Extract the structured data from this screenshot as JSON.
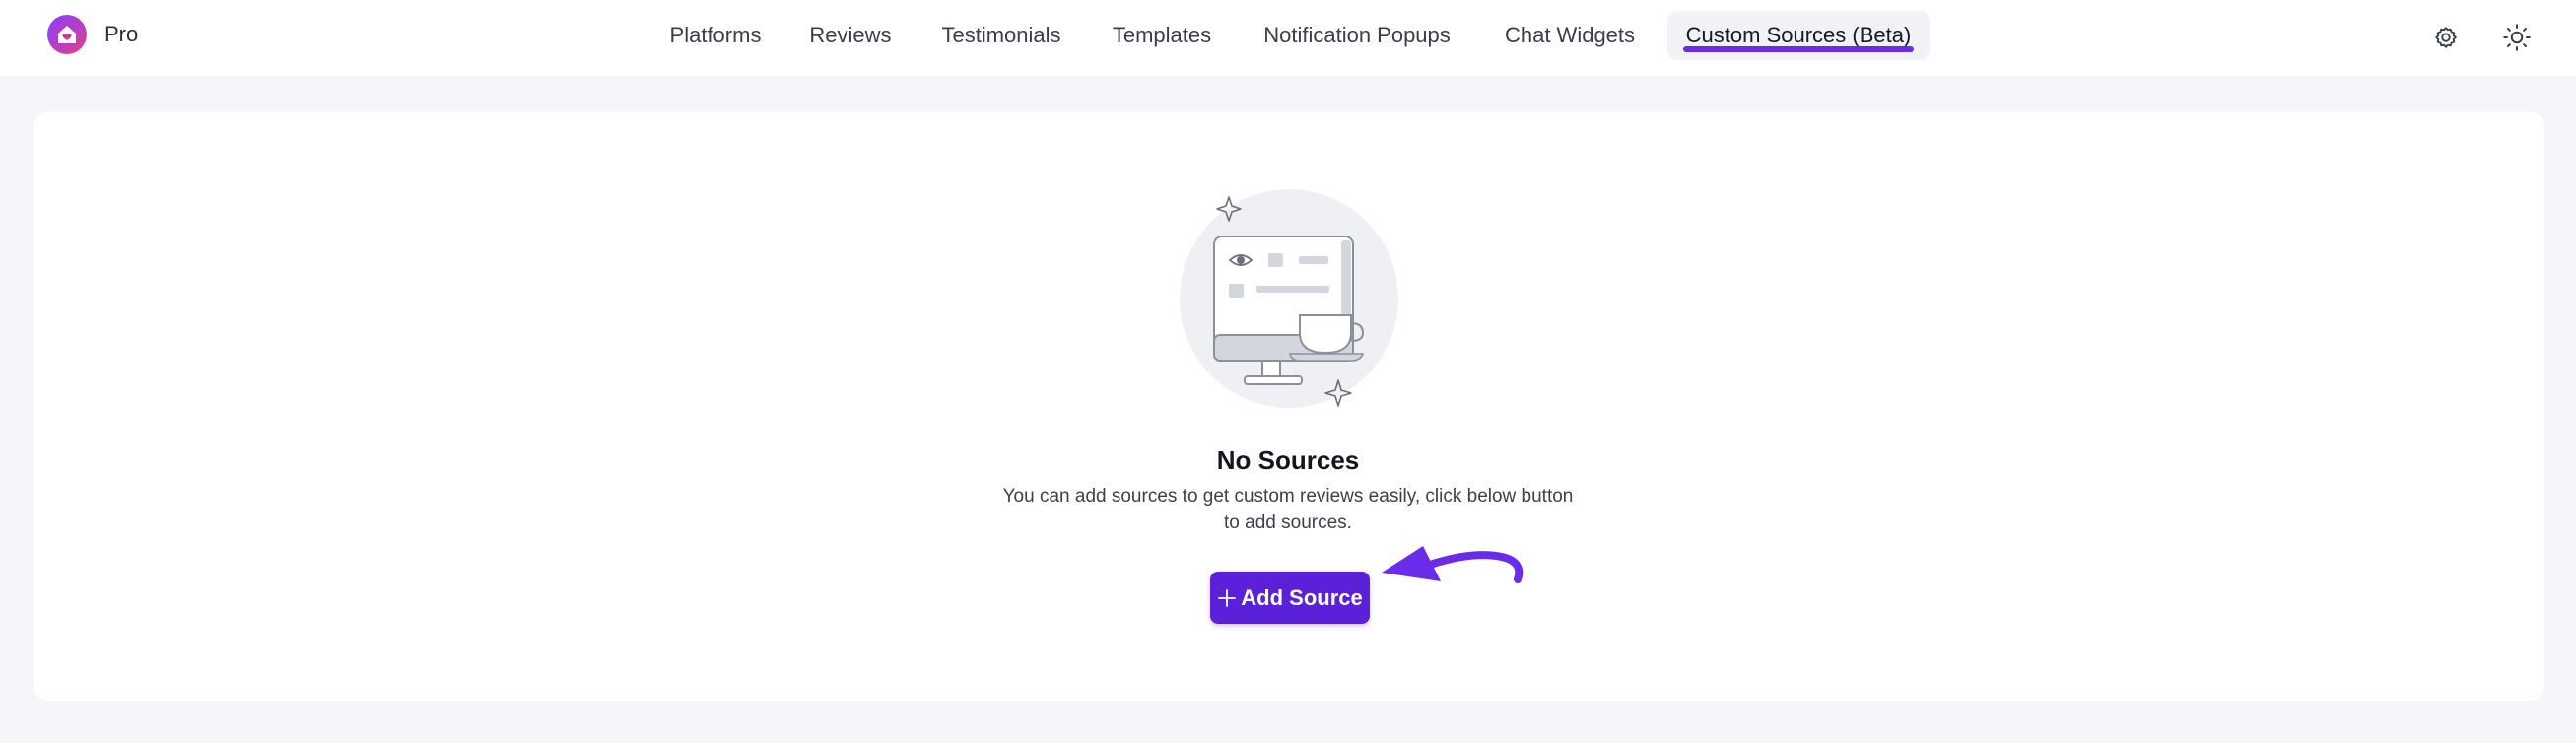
{
  "brand": {
    "name": "Pro",
    "logo_icon": "home-heart-icon"
  },
  "nav": {
    "items": [
      {
        "label": "Platforms",
        "active": false
      },
      {
        "label": "Reviews",
        "active": false
      },
      {
        "label": "Testimonials",
        "active": false
      },
      {
        "label": "Templates",
        "active": false
      },
      {
        "label": "Notification Popups",
        "active": false
      },
      {
        "label": "Chat Widgets",
        "active": false
      },
      {
        "label": "Custom Sources (Beta)",
        "active": true
      }
    ],
    "accent_color": "#6a2ce8"
  },
  "header_actions": {
    "settings_icon": "gear-icon",
    "theme_icon": "sun-icon"
  },
  "empty_state": {
    "illustration": "monitor-with-coffee-cup",
    "title": "No Sources",
    "description_line1": "You can add sources to get custom reviews easily, click below button",
    "description_line2": "to add sources.",
    "button_label": "Add Source",
    "button_icon": "plus-icon",
    "button_color": "#5b21d9"
  }
}
